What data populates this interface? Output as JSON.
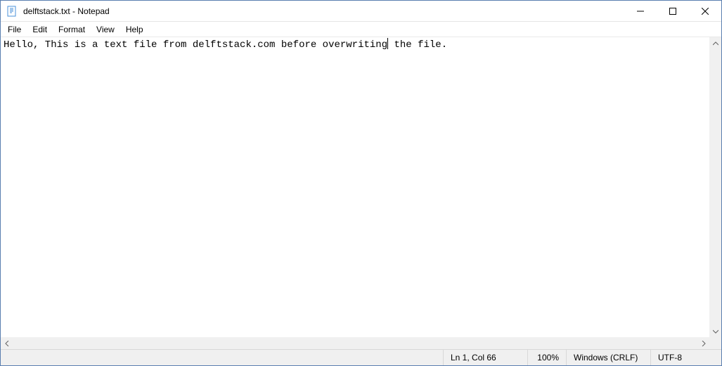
{
  "titlebar": {
    "title": "delftstack.txt - Notepad"
  },
  "menubar": {
    "items": [
      "File",
      "Edit",
      "Format",
      "View",
      "Help"
    ]
  },
  "editor": {
    "text_before_caret": "Hello, This is a text file from delftstack.com before overwriting",
    "text_after_caret": " the file."
  },
  "statusbar": {
    "position": "Ln 1, Col 66",
    "zoom": "100%",
    "line_ending": "Windows (CRLF)",
    "encoding": "UTF-8"
  }
}
